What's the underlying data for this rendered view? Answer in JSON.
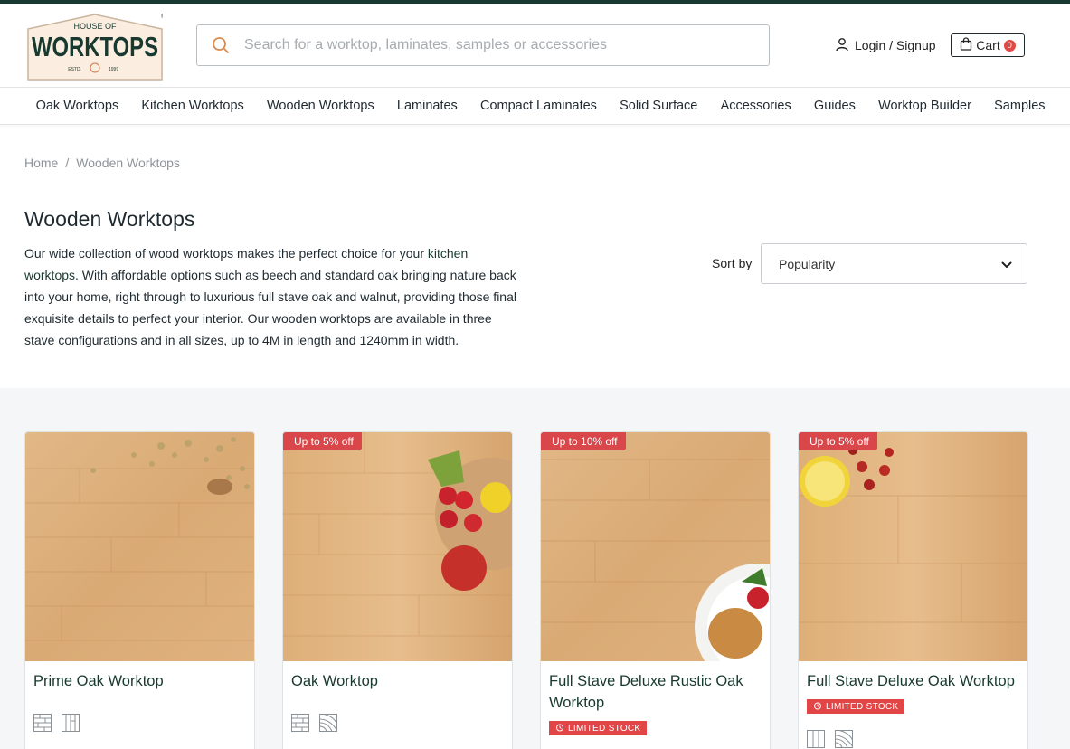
{
  "header": {
    "logo": {
      "line1": "HOUSE OF",
      "line2": "WORKTOPS",
      "estd": "ESTD.",
      "year": "1999"
    },
    "search_placeholder": "Search for a worktop, laminates, samples or accessories",
    "login_label": "Login / Signup",
    "cart_label": "Cart",
    "cart_count": "0"
  },
  "nav": {
    "items": [
      {
        "label": "Oak Worktops"
      },
      {
        "label": "Kitchen Worktops"
      },
      {
        "label": "Wooden Worktops"
      },
      {
        "label": "Laminates"
      },
      {
        "label": "Compact Laminates"
      },
      {
        "label": "Solid Surface"
      },
      {
        "label": "Accessories"
      },
      {
        "label": "Guides"
      },
      {
        "label": "Worktop Builder"
      },
      {
        "label": "Samples"
      }
    ]
  },
  "breadcrumb": {
    "home": "Home",
    "separator": "/",
    "current": "Wooden Worktops"
  },
  "page": {
    "title": "Wooden Worktops",
    "intro_before": "Our wide collection of wood worktops makes the perfect choice for your ",
    "intro_link": "kitchen worktops",
    "intro_after": ". With affordable options such as beech and standard oak bringing nature back into your home, right through to luxurious full stave oak and walnut, providing those final exquisite details to perfect your interior. Our wooden worktops are available in three stave configurations and in all sizes, up to 4M in length and 1240mm in width."
  },
  "sort": {
    "label": "Sort by",
    "selected": "Popularity"
  },
  "products": [
    {
      "name": "Prime Oak Worktop",
      "badge": "",
      "stock": ""
    },
    {
      "name": "Oak Worktop",
      "badge": "Up to 5% off",
      "stock": ""
    },
    {
      "name": "Full Stave Deluxe Rustic Oak Worktop",
      "badge": "Up to 10% off",
      "stock": "LIMITED STOCK"
    },
    {
      "name": "Full Stave Deluxe Oak Worktop",
      "badge": "Up to 5% off",
      "stock": "LIMITED STOCK"
    }
  ],
  "colors": {
    "brand": "#17392f",
    "badge": "#d9474a",
    "wood": "#dcae78"
  }
}
